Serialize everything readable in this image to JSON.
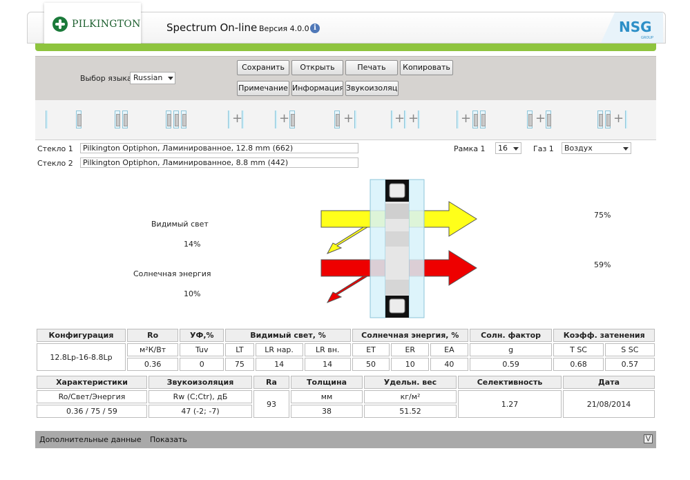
{
  "header": {
    "logo_text": "PILKINGTON",
    "title": "Spectrum On-line",
    "version": "Версия  4.0.0",
    "info_icon": "info-icon",
    "partner_logo": "NSG",
    "partner_sub": "GROUP",
    "accent_color": "#8ec43e"
  },
  "toolbar": {
    "language_label": "Выбор языка",
    "language_value": "Russian",
    "buttons": {
      "save": "Сохранить",
      "open": "Открыть",
      "print": "Печать",
      "copy": "Копировать",
      "note": "Примечание",
      "info": "Информация",
      "sound": "Звукоизоляци"
    }
  },
  "glass": {
    "glass1_label": "Стекло 1",
    "glass1_value": "Pilkington Optiphon, Ламинированное, 12.8 mm (662)",
    "glass2_label": "Стекло 2",
    "glass2_value": "Pilkington Optiphon, Ламинированное, 8.8 mm (442)",
    "frame_label": "Рамка 1",
    "frame_value": "16",
    "gas_label": "Газ 1",
    "gas_value": "Воздух"
  },
  "diagram": {
    "visible_label": "Видимый свет",
    "visible_reflect": "14%",
    "visible_trans": "75%",
    "solar_label": "Солнечная энергия",
    "solar_reflect": "10%",
    "solar_trans": "59%",
    "visible_color": "#ffff1a",
    "solar_color": "#ee0000"
  },
  "table1": {
    "headers": [
      "Конфигурация",
      "Ro",
      "УФ,%",
      "Видимый свет, %",
      "Солнечная энергия, %",
      "Солн. фактор",
      "Коэфф. затенения"
    ],
    "config_value": "12.8Lp-16-8.8Lp",
    "units": [
      "м²К/Вт",
      "Tuv",
      "LT",
      "LR нар.",
      "LR вн.",
      "ET",
      "ER",
      "EA",
      "g",
      "T SC",
      "S SC"
    ],
    "values": [
      "0.36",
      "0",
      "75",
      "14",
      "14",
      "50",
      "10",
      "40",
      "0.59",
      "0.68",
      "0.57"
    ]
  },
  "table2": {
    "headers": [
      "Характеристики",
      "Звукоизоляция",
      "Ra",
      "Толщина",
      "Удельн. вес",
      "Селективность",
      "Дата"
    ],
    "units": [
      "Ro/Свет/Энергия",
      "Rw (C;Ctr), дБ",
      "мм",
      "кг/м²"
    ],
    "values": [
      "0.36 / 75 / 59",
      "47 (-2; -7)",
      "93",
      "38",
      "51.52",
      "1.27",
      "21/08/2014"
    ]
  },
  "bottom": {
    "label": "Дополнительные данные",
    "show": "Показать",
    "icon": "double-chevron-down-icon"
  }
}
